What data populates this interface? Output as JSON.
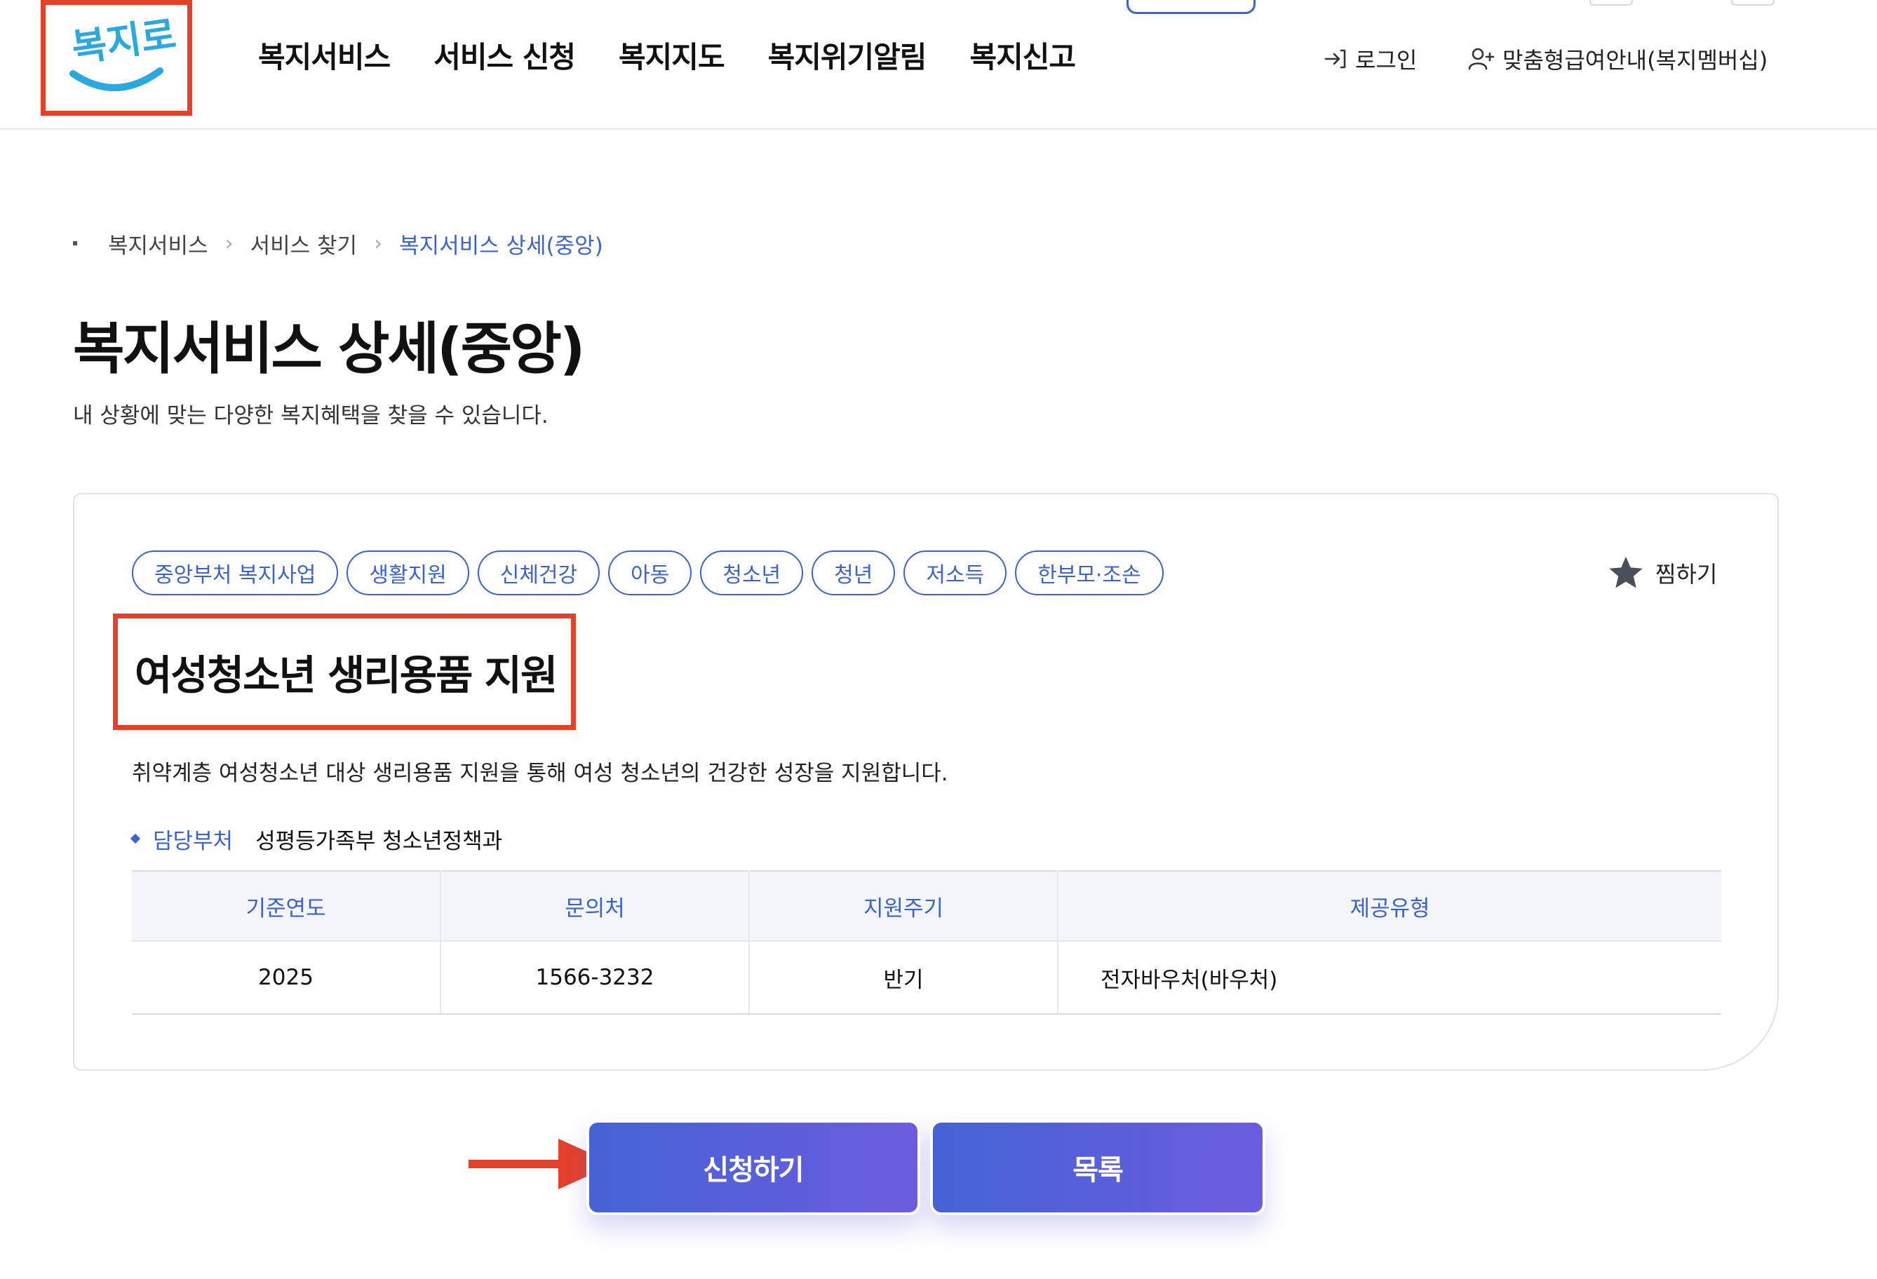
{
  "header": {
    "logo_text": "복지로",
    "nav": [
      "복지서비스",
      "서비스 신청",
      "복지지도",
      "복지위기알림",
      "복지신고"
    ],
    "login_label": "로그인",
    "member_label": "맞춤형급여안내(복지멤버십)"
  },
  "breadcrumb": {
    "items": [
      "복지서비스",
      "서비스 찾기"
    ],
    "current": "복지서비스 상세(중앙)"
  },
  "page": {
    "title": "복지서비스 상세(중앙)",
    "description": "내 상황에 맞는 다양한 복지혜택을 찾을 수 있습니다."
  },
  "service": {
    "tags": [
      "중앙부처 복지사업",
      "생활지원",
      "신체건강",
      "아동",
      "청소년",
      "청년",
      "저소득",
      "한부모·조손"
    ],
    "favorite_label": "찜하기",
    "title": "여성청소년 생리용품 지원",
    "description": "취약계층 여성청소년 대상 생리용품 지원을 통해 여성 청소년의 건강한 성장을 지원합니다.",
    "dept_label": "담당부처",
    "dept_value": "성평등가족부 청소년정책과",
    "table": {
      "headers": [
        "기준연도",
        "문의처",
        "지원주기",
        "제공유형"
      ],
      "row": [
        "2025",
        "1566-3232",
        "반기",
        "전자바우처(바우처)"
      ]
    }
  },
  "buttons": {
    "apply_label": "신청하기",
    "list_label": "목록"
  },
  "colors": {
    "accent": "#3a63d0",
    "highlight_red": "#e5402a",
    "button_gradient_start": "#4563d6",
    "button_gradient_end": "#6c5ce0"
  }
}
